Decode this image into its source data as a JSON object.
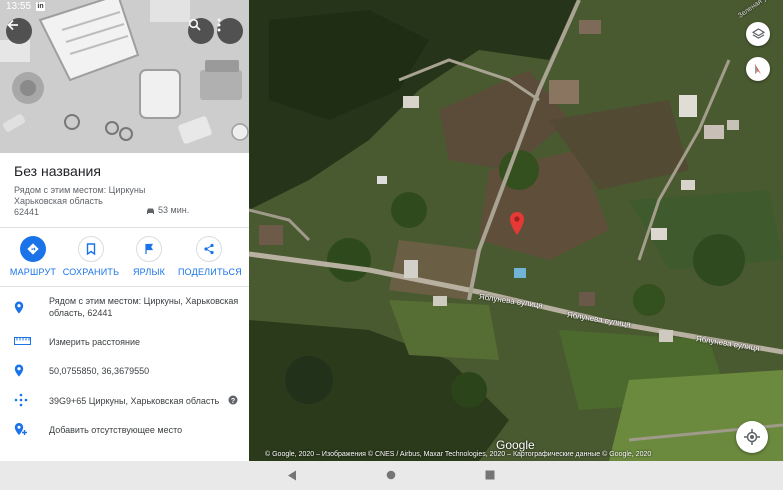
{
  "status": {
    "time": "13:55",
    "notif": "in"
  },
  "place": {
    "title": "Без названия",
    "address_line1": "Рядом с этим местом: Циркуны",
    "address_line2": "Харьковская область",
    "address_line3": "62441",
    "drive_time": "53 мин."
  },
  "actions": [
    {
      "label": "МАРШРУТ",
      "icon": "directions-icon"
    },
    {
      "label": "СОХРАНИТЬ",
      "icon": "bookmark-icon"
    },
    {
      "label": "ЯРЛЫК",
      "icon": "flag-icon"
    },
    {
      "label": "ПОДЕЛИТЬСЯ",
      "icon": "share-icon"
    }
  ],
  "details": {
    "address_line1": "Рядом с этим местом: Циркуны, Харьковская",
    "address_line2": "область, 62441",
    "measure": "Измерить расстояние",
    "coordinates": "50,0755850, 36,3679550",
    "plus_code": "39G9+65 Циркуны, Харьковская область",
    "add_place": "Добавить отсутствующее место"
  },
  "map": {
    "street_1": "Яблунева вулиця",
    "street_2": "Яблунева вулиця",
    "street_3": "Яблунева вулиця",
    "corner_label": "Зеленая ул.",
    "logo": "Google",
    "attribution": "© Google, 2020 – Изображения © CNES / Airbus, Maxar Technologies, 2020 – Картографические данные © Google, 2020"
  },
  "colors": {
    "accent": "#1a73e8",
    "pin": "#e53935"
  }
}
